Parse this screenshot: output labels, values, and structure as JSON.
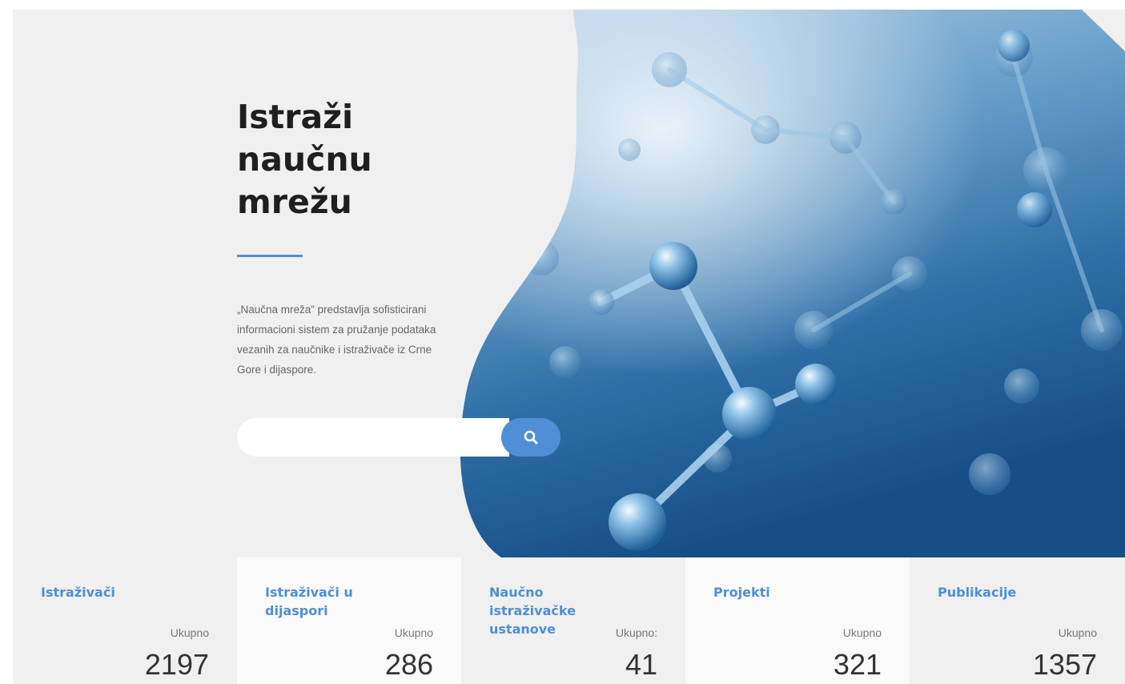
{
  "hero": {
    "title_lines": [
      "Istraži",
      "naučnu",
      "mrežu"
    ],
    "description": "„Naučna mreža” predstavlja sofisticirani informacioni sistem za pružanje podataka vezanih za naučnike i istraživače iz Crne Gore i dijaspore.",
    "image": "molecule-structure-image",
    "accent_color": "#4e8fd6"
  },
  "search": {
    "value": "",
    "placeholder": "",
    "icon": "search-icon"
  },
  "stats": [
    {
      "title": "Istraživači",
      "total_label": "Ukupno",
      "count": "2197"
    },
    {
      "title": "Istraživači u dijaspori",
      "total_label": "Ukupno",
      "count": "286"
    },
    {
      "title": "Naučno istraživačke ustanove",
      "total_label": "Ukupno:",
      "count": "41"
    },
    {
      "title": "Projekti",
      "total_label": "Ukupno",
      "count": "321"
    },
    {
      "title": "Publikacije",
      "total_label": "Ukupno",
      "count": "1357"
    }
  ]
}
